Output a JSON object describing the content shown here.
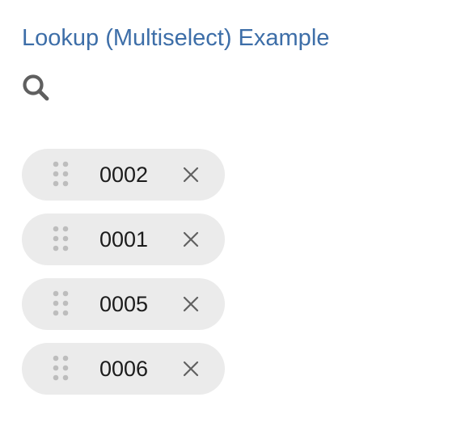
{
  "header": {
    "title": "Lookup (Multiselect) Example"
  },
  "search": {
    "icon": "search-icon",
    "icon_color": "#5f5f5f"
  },
  "selected_items": [
    {
      "label": "0002",
      "drag_icon": "drag-handle-icon",
      "remove_icon": "close-icon"
    },
    {
      "label": "0001",
      "drag_icon": "drag-handle-icon",
      "remove_icon": "close-icon"
    },
    {
      "label": "0005",
      "drag_icon": "drag-handle-icon",
      "remove_icon": "close-icon"
    },
    {
      "label": "0006",
      "drag_icon": "drag-handle-icon",
      "remove_icon": "close-icon"
    }
  ],
  "colors": {
    "title": "#3d6ea8",
    "chip_background": "#ebebeb",
    "drag_handle": "#bdbdbd",
    "close_icon": "#616161"
  }
}
